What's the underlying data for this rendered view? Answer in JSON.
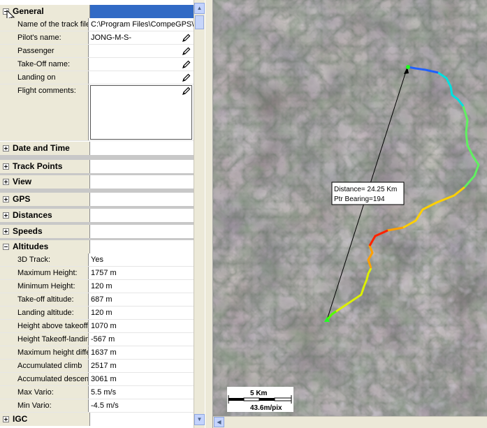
{
  "sections": {
    "general": "General",
    "date_time": "Date and Time",
    "track_points": "Track Points",
    "view": "View",
    "gps": "GPS",
    "distances": "Distances",
    "speeds": "Speeds",
    "altitudes": "Altitudes",
    "igc": "IGC"
  },
  "general": {
    "track_file_label": "Name of the track file",
    "track_file_value": "C:\\Program Files\\CompeGPS\\t",
    "pilot_label": "Pilot's name:",
    "pilot_value": "JONG-M-S-",
    "passenger_label": "Passenger",
    "takeoff_name_label": "Take-Off name:",
    "landing_label": "Landing on",
    "comments_label": "Flight comments:"
  },
  "altitudes": {
    "track3d_label": "3D Track:",
    "track3d_value": "Yes",
    "max_height_label": "Maximum Height:",
    "max_height_value": "1757 m",
    "min_height_label": "Minimum Height:",
    "min_height_value": "120 m",
    "takeoff_alt_label": "Take-off altitude:",
    "takeoff_alt_value": "687 m",
    "landing_alt_label": "Landing altitude:",
    "landing_alt_value": "120 m",
    "height_above_label": "Height above takeoff",
    "height_above_value": "1070 m",
    "height_diff_label": "Height Takeoff-landin",
    "height_diff_value": "-567 m",
    "max_height_diff_label": "Maximum height differ",
    "max_height_diff_value": "1637 m",
    "acc_climb_label": "Accumulated climb",
    "acc_climb_value": "2517 m",
    "acc_descent_label": "Accumulated descen",
    "acc_descent_value": "3061 m",
    "max_vario_label": "Max Vario:",
    "max_vario_value": "5.5 m/s",
    "min_vario_label": "Min Vario:",
    "min_vario_value": "-4.5 m/s"
  },
  "map": {
    "distance_text": "Distance= 24.25 Km",
    "bearing_text": "Ptr Bearing=194",
    "scale_label": "5 Km",
    "resolution_label": "43.6m/pix"
  },
  "colors": {
    "selected_row": "#316ac5",
    "track_start": "#00ff00",
    "track_end": "#0050ff"
  }
}
